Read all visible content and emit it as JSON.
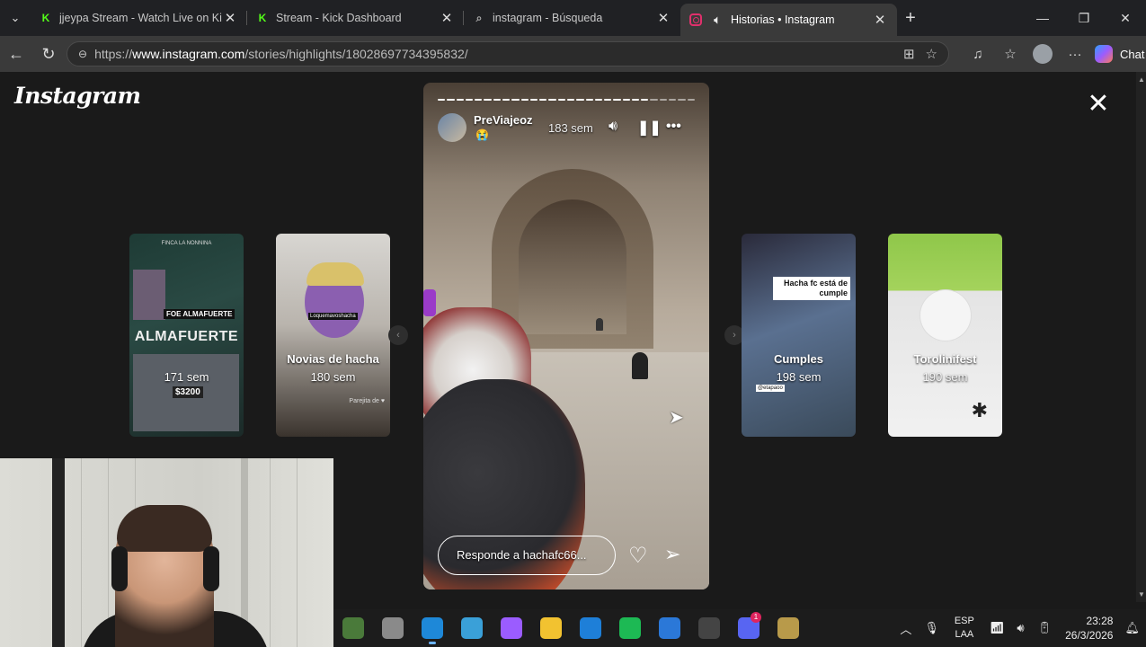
{
  "browser": {
    "tabs": [
      {
        "title": "jjeypa Stream - Watch Live on Kick",
        "favicon": "kick-icon"
      },
      {
        "title": "Stream - Kick Dashboard",
        "favicon": "kick-icon"
      },
      {
        "title": "instagram - Búsqueda",
        "favicon": "search-icon"
      },
      {
        "title": "Historias • Instagram",
        "favicon": "instagram-icon",
        "active": true
      }
    ],
    "url_prefix": "https://",
    "url_domain": "www.instagram.com",
    "url_path": "/stories/highlights/18028697734395832/",
    "copilot_label": "Chat"
  },
  "instagram": {
    "logo_text": "Instagram",
    "story": {
      "username": "PreViajeoz",
      "emoji": "😭",
      "age": "183 sem",
      "reply_placeholder": "Responde a hachafc66...",
      "segments_total": 28,
      "segments_done": 23
    },
    "highlights": [
      {
        "name": "",
        "age": "171 sem",
        "overlay_header": "FINCA LA NONNINA",
        "overlay_big": "ALMAFUERTE",
        "overlay_alma": "FOE ALMAFUERTE",
        "overlay_price": "$3200"
      },
      {
        "name": "Novias de hacha",
        "age": "180 sem",
        "overlay_sticker": "Loquemavoshacha",
        "overlay_tag": "Parejita de ♥"
      },
      {
        "name": "Cumples",
        "age": "198 sem",
        "overlay_label": "Hacha fc está de cumple",
        "overlay_sticker": "@etapaoo"
      },
      {
        "name": "Torolinifest",
        "age": "190 sem"
      }
    ]
  },
  "taskbar": {
    "apps": [
      {
        "name": "widgets",
        "color": "#4a7a3a"
      },
      {
        "name": "task-view",
        "color": "#8a8a8a"
      },
      {
        "name": "edge",
        "color": "#1e88d8",
        "active": true
      },
      {
        "name": "kick-app",
        "color": "#3aa0d8"
      },
      {
        "name": "copilot",
        "color": "#9b5cff"
      },
      {
        "name": "file-explorer",
        "color": "#f2c230"
      },
      {
        "name": "notes",
        "color": "#1e7fd8"
      },
      {
        "name": "spotify",
        "color": "#1db954"
      },
      {
        "name": "store",
        "color": "#2b78d8"
      },
      {
        "name": "obs",
        "color": "#444444",
        "badge": ""
      },
      {
        "name": "discord",
        "color": "#5865f2",
        "badge": "1"
      },
      {
        "name": "league",
        "color": "#b89a4a"
      }
    ],
    "lang_top": "ESP",
    "lang_bottom": "LAA",
    "time": "23:28",
    "date": "26/3/2026"
  }
}
